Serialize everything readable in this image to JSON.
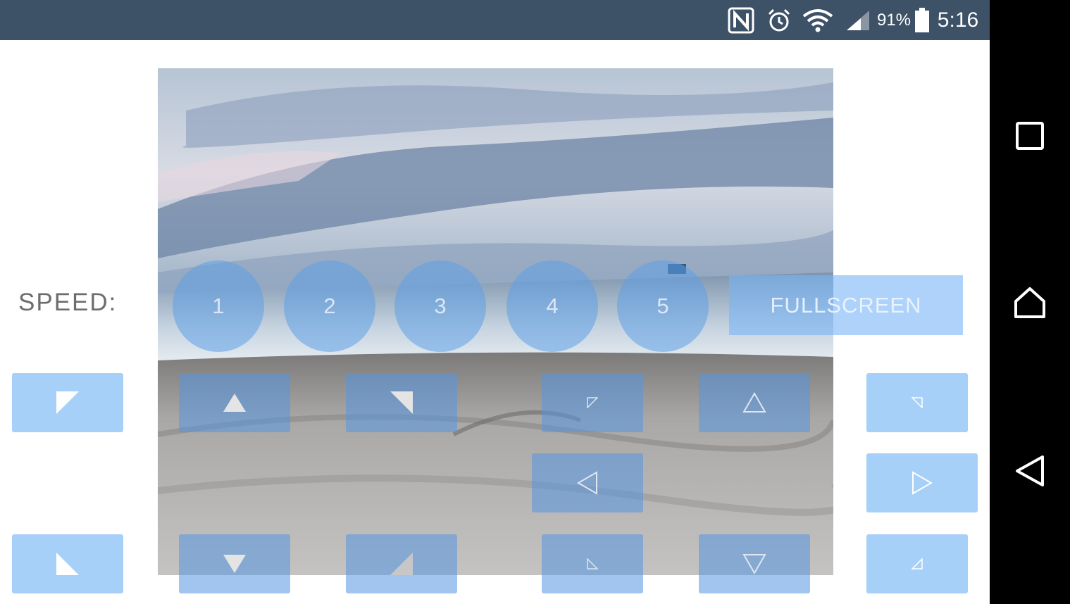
{
  "status_bar": {
    "icons": [
      "nfc-icon",
      "alarm-icon",
      "wifi-icon",
      "signal-icon",
      "battery-icon"
    ],
    "battery_percent": "91%",
    "time": "5:16"
  },
  "speed": {
    "label": "SPEED:",
    "buttons": [
      "1",
      "2",
      "3",
      "4",
      "5"
    ]
  },
  "fullscreen": {
    "label": "FULLSCREEN"
  },
  "controls": {
    "left_top": "forward-left-icon",
    "left_bottom": "backward-right-icon",
    "row1": [
      "up-triangle-icon",
      "turn-left-forward-icon",
      "small-corner-icon",
      "up-outline-icon"
    ],
    "row2": [
      "left-outline-icon"
    ],
    "row3": [
      "down-triangle-icon",
      "turn-right-backward-icon",
      "small-corner-icon",
      "down-outline-icon"
    ],
    "right": [
      "small-corner-icon",
      "right-outline-icon",
      "small-corner-icon"
    ]
  },
  "navigation": [
    "recents-icon",
    "home-icon",
    "back-icon"
  ],
  "colors": {
    "status_bar": "#3d5167",
    "button_solid": "#a6d0f7",
    "button_overlay": "#5596e1",
    "nav_bar": "#000000"
  }
}
